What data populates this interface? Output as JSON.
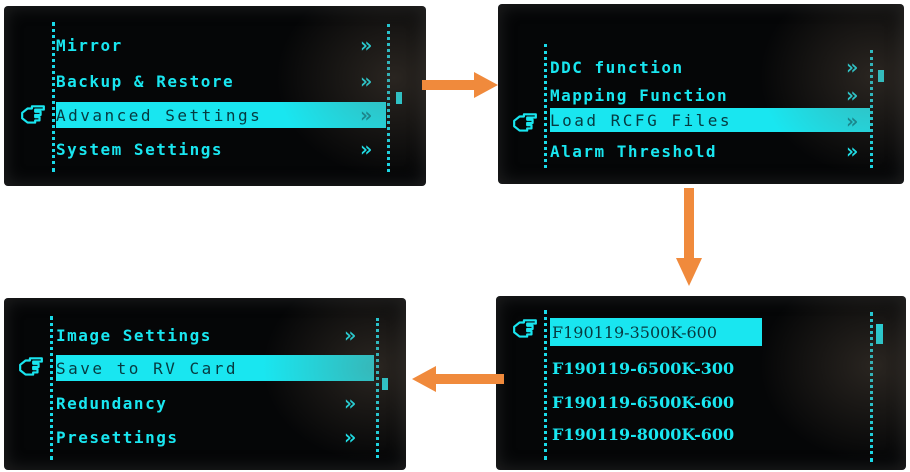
{
  "colors": {
    "accent": "#19e6f0",
    "arrow": "#f08a3c",
    "screen_bg": "#050607"
  },
  "icons": {
    "pointer": "pointing-hand-icon",
    "more": "double-chevron-right-icon"
  },
  "screen1": {
    "items": [
      {
        "label": "Mirror"
      },
      {
        "label": "Backup & Restore"
      },
      {
        "label": "Advanced  Settings"
      },
      {
        "label": "System Settings"
      }
    ]
  },
  "screen2": {
    "items": [
      {
        "label": "DDC function"
      },
      {
        "label": "Mapping Function"
      },
      {
        "label": "Load RCFG Files"
      },
      {
        "label": "Alarm Threshold"
      }
    ]
  },
  "screen3": {
    "items": [
      {
        "label": "F190119-3500K-600"
      },
      {
        "label": "F190119-6500K-300"
      },
      {
        "label": "F190119-6500K-600"
      },
      {
        "label": "F190119-8000K-600"
      }
    ]
  },
  "screen4": {
    "items": [
      {
        "label": "Image Settings"
      },
      {
        "label": "Save to RV Card"
      },
      {
        "label": "Redundancy"
      },
      {
        "label": "Presettings"
      }
    ]
  }
}
